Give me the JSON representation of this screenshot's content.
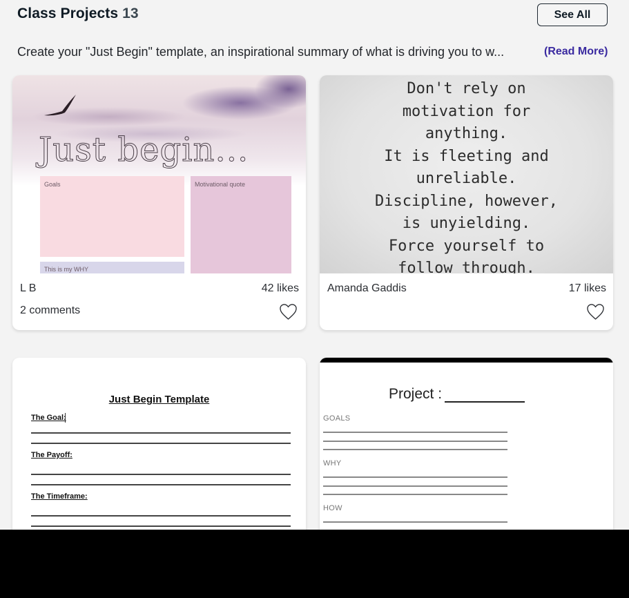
{
  "header": {
    "title": "Class Projects",
    "count": "13",
    "see_all_label": "See All"
  },
  "description": {
    "text": "Create your \"Just Begin\" template, an inspirational summary of what is driving you to w...",
    "read_more_label": "(Read More)"
  },
  "colors": {
    "accent_link": "#3a2aa0",
    "title_text": "#0e1a24",
    "background": "#f3f3f3"
  },
  "projects": [
    {
      "author": "L B",
      "likes": "42 likes",
      "comments": "2 comments",
      "thumbnail": {
        "title": "Just begin...",
        "boxes": [
          "Goals",
          "Motivational quote",
          "This is my WHY"
        ]
      },
      "icon": "heart-outline-icon"
    },
    {
      "author": "Amanda Gaddis",
      "likes": "17 likes",
      "comments": "",
      "thumbnail": {
        "quote_lines": [
          "Don't rely on",
          "motivation for",
          "anything.",
          "It is fleeting and",
          "unreliable.",
          "Discipline, however,",
          "is unyielding.",
          "Force yourself to",
          "follow through."
        ]
      },
      "icon": "heart-outline-icon"
    },
    {
      "thumbnail": {
        "title": "Just Begin Template",
        "labels": [
          "The Goal:",
          "The Payoff:",
          "The Timeframe:"
        ]
      }
    },
    {
      "thumbnail": {
        "title": "Project :",
        "sections": [
          "GOALS",
          "WHY",
          "HOW"
        ]
      }
    }
  ]
}
